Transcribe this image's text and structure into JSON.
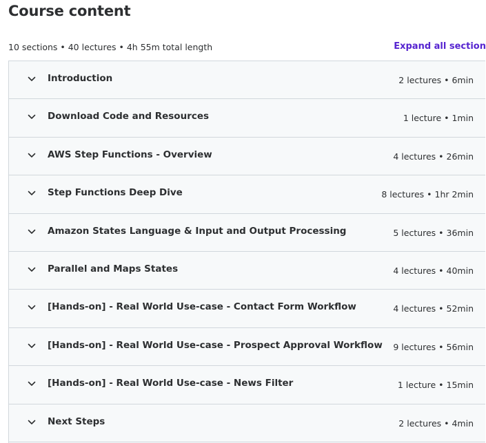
{
  "header": {
    "title": "Course content",
    "summary": "10 sections • 40 lectures • 4h 55m total length",
    "expand_label": "Expand all section"
  },
  "sections": [
    {
      "title": "Introduction",
      "meta": "2 lectures • 6min"
    },
    {
      "title": "Download Code and Resources",
      "meta": "1 lecture • 1min"
    },
    {
      "title": "AWS Step Functions - Overview",
      "meta": "4 lectures • 26min"
    },
    {
      "title": "Step Functions Deep Dive",
      "meta": "8 lectures • 1hr 2min"
    },
    {
      "title": "Amazon States Language & Input and Output Processing",
      "meta": "5 lectures • 36min"
    },
    {
      "title": "Parallel and Maps States",
      "meta": "4 lectures • 40min"
    },
    {
      "title": "[Hands-on] - Real World Use-case - Contact Form Workflow",
      "meta": "4 lectures • 52min"
    },
    {
      "title": "[Hands-on] - Real World Use-case - Prospect Approval Workflow",
      "meta": "9 lectures • 56min"
    },
    {
      "title": "[Hands-on] - Real World Use-case - News Filter",
      "meta": "1 lecture • 15min"
    },
    {
      "title": "Next Steps",
      "meta": "2 lectures • 4min"
    }
  ],
  "icons": {
    "section_toggle": "chevron-down-icon"
  },
  "colors": {
    "accent": "#5624d0",
    "row_bg": "#f7f9fa",
    "border": "#d1d7dc",
    "text": "#2d2f31"
  }
}
